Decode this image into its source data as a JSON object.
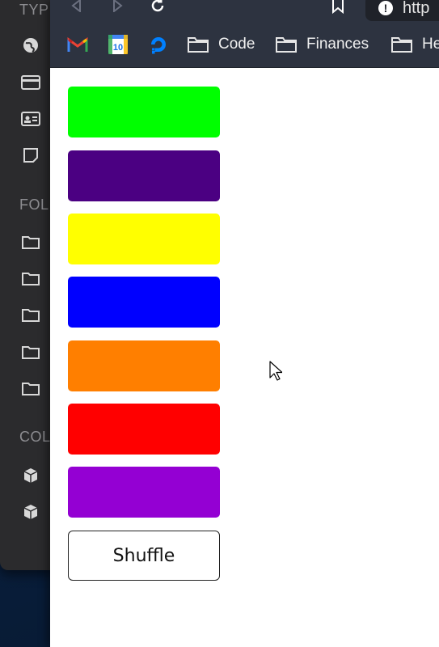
{
  "background_window": {
    "headings": [
      "TYPE",
      "FOL",
      "COL"
    ],
    "type_icons": [
      "globe-icon",
      "card-icon",
      "id-card-icon",
      "note-icon"
    ],
    "folder_count": 5,
    "collection_count": 2
  },
  "browser": {
    "url": "http",
    "bookmarks": [
      {
        "kind": "icon",
        "name": "gmail-icon"
      },
      {
        "kind": "icon",
        "name": "calendar-icon",
        "text": "10"
      },
      {
        "kind": "icon",
        "name": "digitalocean-icon"
      },
      {
        "kind": "folder",
        "label": "Code"
      },
      {
        "kind": "folder",
        "label": "Finances"
      },
      {
        "kind": "folder",
        "label": "He"
      }
    ]
  },
  "page": {
    "swatches": [
      {
        "color": "#00ff00"
      },
      {
        "color": "#4b0082"
      },
      {
        "color": "#ffff00"
      },
      {
        "color": "#0000ff"
      },
      {
        "color": "#ff7f00"
      },
      {
        "color": "#ff0000"
      },
      {
        "color": "#9400d3"
      }
    ],
    "shuffle_label": "Shuffle"
  }
}
